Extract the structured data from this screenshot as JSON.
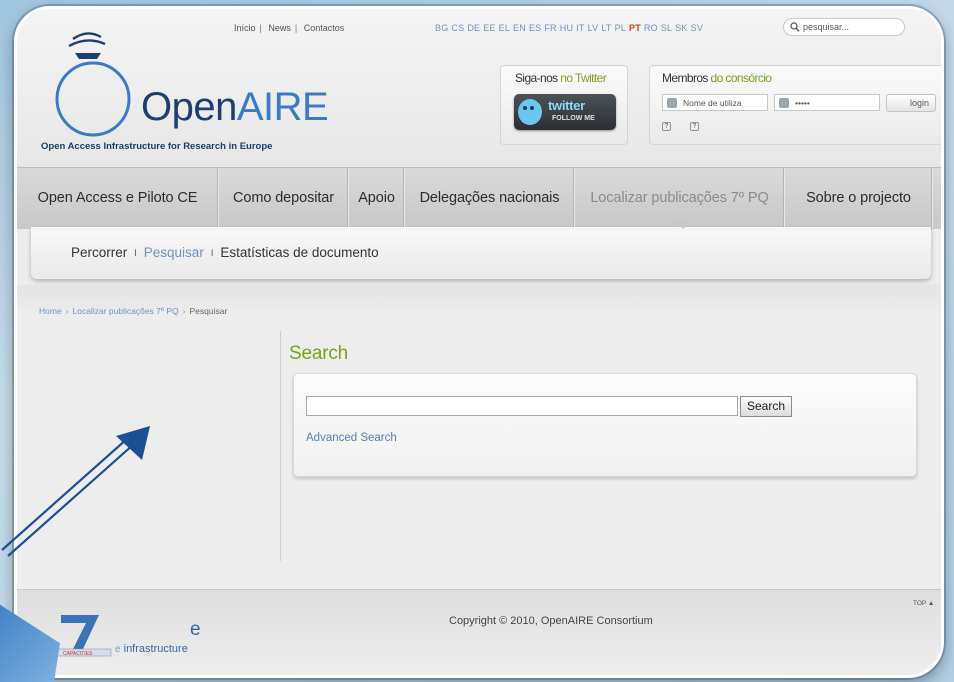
{
  "header": {
    "top_links": [
      "Início",
      "News",
      "Contactos"
    ],
    "languages": [
      "BG",
      "CS",
      "DE",
      "EE",
      "EL",
      "EN",
      "ES",
      "FR",
      "HU",
      "IT",
      "LV",
      "LT",
      "PL",
      "PT",
      "RO",
      "SL",
      "SK",
      "SV"
    ],
    "active_language": "PT",
    "search_placeholder": "pesquisar...",
    "logo_open": "Open",
    "logo_aire": "AIRE",
    "tagline": "Open Access Infrastructure for Research in Europe"
  },
  "twitter": {
    "title_prefix": "Siga-nos",
    "title_suffix": "no Twitter",
    "badge_word": "twitter",
    "badge_follow": "FOLLOW ME"
  },
  "members": {
    "title_prefix": "Membros",
    "title_suffix": "do consórcio",
    "username_placeholder": "Nome de utiliza",
    "password_value": "•••••",
    "login_label": "login"
  },
  "nav": {
    "items": [
      "Open Access e Piloto CE",
      "Como depositar",
      "Apoio",
      "Delegações nacionais",
      "Localizar publicações 7º PQ",
      "Sobre o projecto"
    ],
    "active_index": 4
  },
  "subnav": {
    "items": [
      "Percorrer",
      "Pesquisar",
      "Estatísticas de documento"
    ],
    "active_index": 1
  },
  "breadcrumb": [
    "Home",
    "Localizar publicações 7º PQ",
    "Pesquisar"
  ],
  "main": {
    "title": "Search",
    "search_value": "",
    "search_button": "Search",
    "advanced_link": "Advanced Search"
  },
  "footer": {
    "copyright": "Copyright © 2010, OpenAIRE Consortium",
    "top_link": "TOP ▲",
    "fp7_label": "CAPACITIES",
    "einfra_e": "e",
    "einfra_rest": "infrastructure"
  },
  "colors": {
    "accent_green": "#7aa21a",
    "link_blue": "#6d93c4",
    "logo_dark": "#1d3e6f"
  }
}
